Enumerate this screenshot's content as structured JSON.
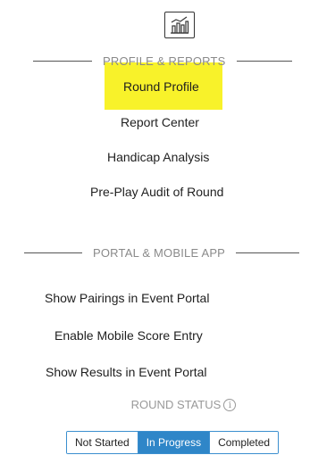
{
  "profile_reports": {
    "header": "PROFILE & REPORTS",
    "icon": "bar-chart-report-icon",
    "highlight_color": "#f8f22a",
    "items": [
      {
        "label": "Round Profile"
      },
      {
        "label": "Report Center"
      },
      {
        "label": "Handicap Analysis"
      },
      {
        "label": "Pre-Play Audit of Round"
      }
    ]
  },
  "portal_mobile": {
    "header": "PORTAL & MOBILE APP",
    "items": [
      {
        "label": "Show Pairings in Event Portal"
      },
      {
        "label": "Enable Mobile Score Entry"
      },
      {
        "label": "Show Results in Event Portal"
      }
    ]
  },
  "round_status": {
    "label": "ROUND STATUS",
    "info_icon": "info-icon",
    "selected": "In Progress",
    "accent_color": "#2f86c8",
    "options": [
      {
        "label": "Not Started"
      },
      {
        "label": "In Progress"
      },
      {
        "label": "Completed"
      }
    ]
  }
}
